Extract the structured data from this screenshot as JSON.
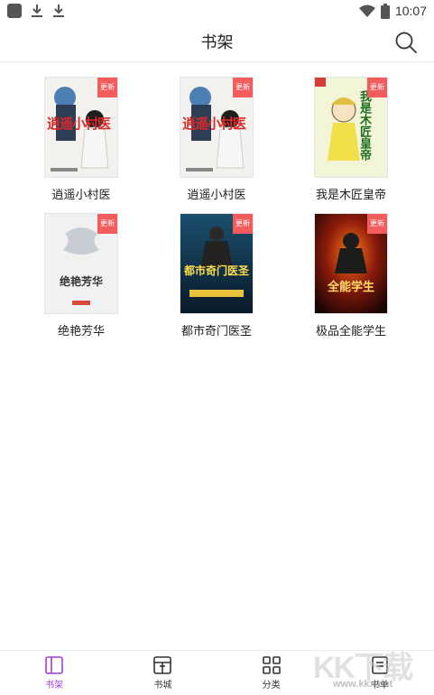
{
  "status_bar": {
    "time": "10:07"
  },
  "header": {
    "title": "书架"
  },
  "books": [
    {
      "title": "逍遥小村医",
      "cover_text": "逍遥小村医",
      "badge": "更新"
    },
    {
      "title": "逍遥小村医",
      "cover_text": "逍遥小村医",
      "badge": "更新"
    },
    {
      "title": "我是木匠皇帝",
      "cover_text": "我是木匠皇帝",
      "badge": "更新"
    },
    {
      "title": "绝艳芳华",
      "cover_text": "绝艳芳华",
      "badge": "更新"
    },
    {
      "title": "都市奇门医圣",
      "cover_text": "都市奇门医圣",
      "badge": "更新"
    },
    {
      "title": "极品全能学生",
      "cover_text": "全能学生",
      "badge": "更新"
    }
  ],
  "tabbar": {
    "items": [
      {
        "label": "书架",
        "icon": "bookshelf-icon",
        "active": true
      },
      {
        "label": "书城",
        "icon": "bookstore-icon",
        "active": false
      },
      {
        "label": "分类",
        "icon": "category-icon",
        "active": false
      },
      {
        "label": "书单",
        "icon": "booklist-icon",
        "active": false
      }
    ]
  },
  "watermark": {
    "brand": "KK下载",
    "url": "www.kkx.net"
  },
  "colors": {
    "accent": "#a23ed6",
    "badge": "#f25c5c"
  }
}
